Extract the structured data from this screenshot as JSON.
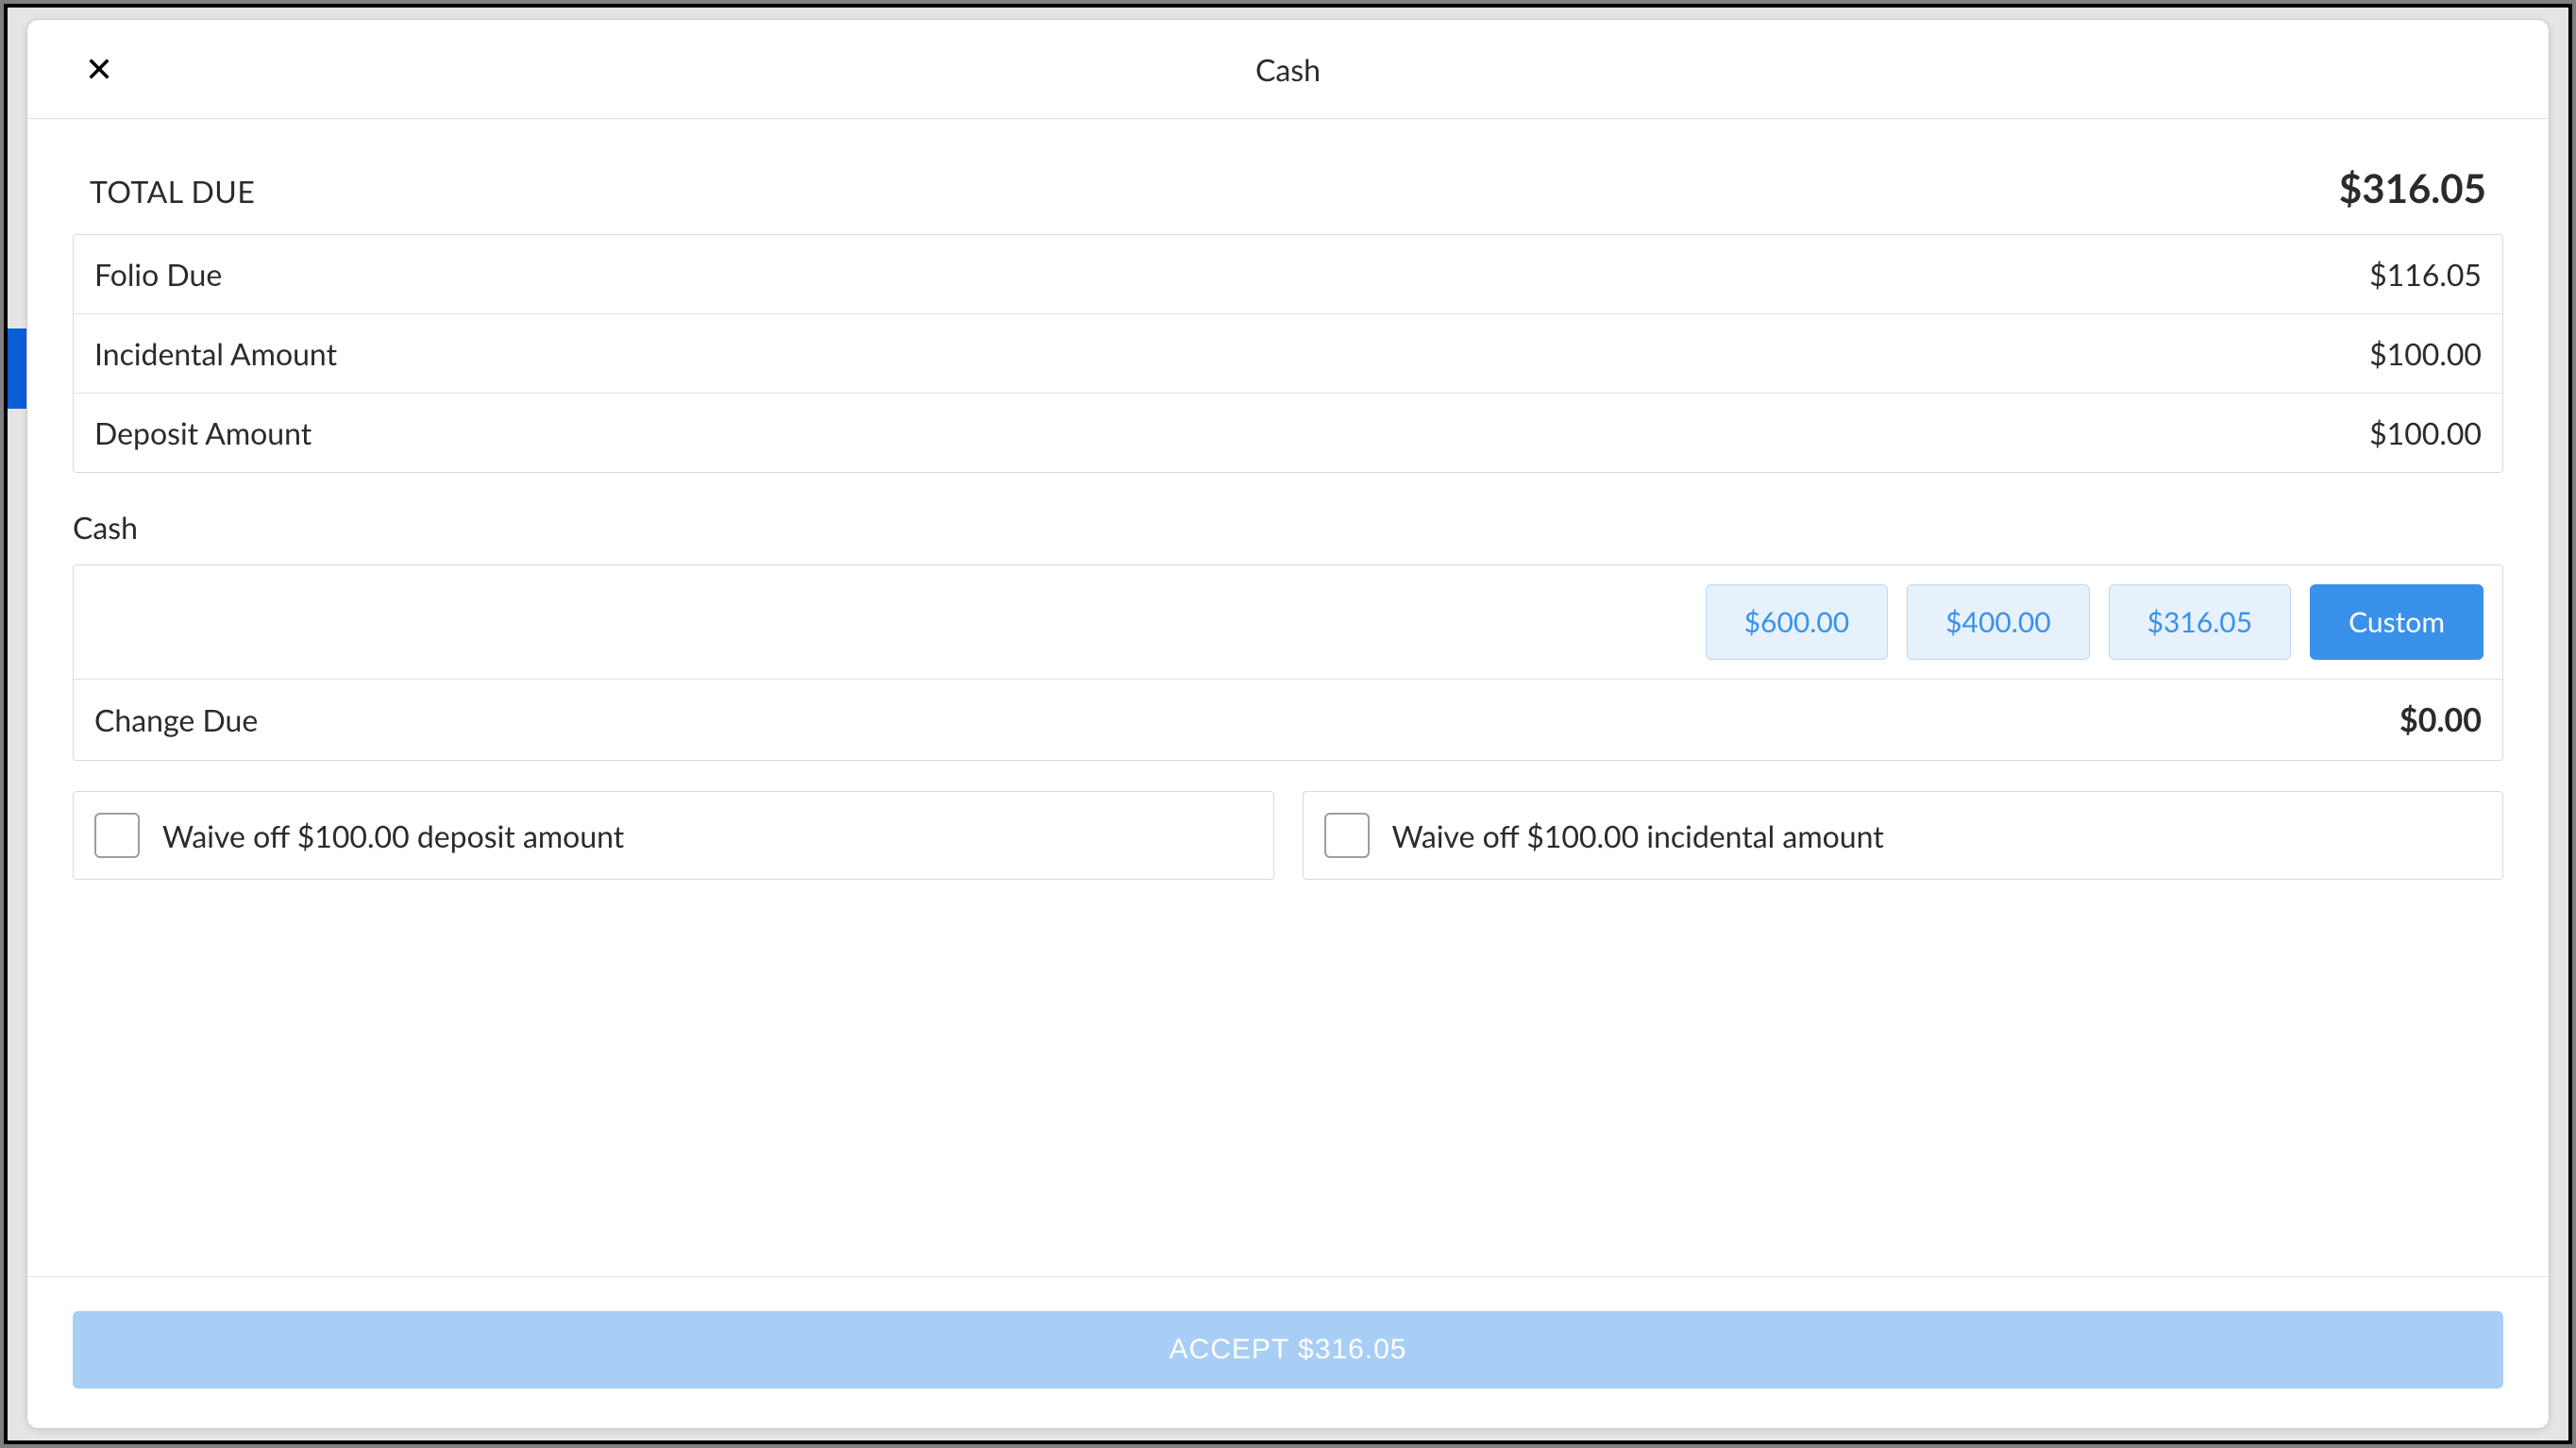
{
  "modal": {
    "title": "Cash",
    "total_due_label": "TOTAL DUE",
    "total_due_amount": "$316.05",
    "breakdown": [
      {
        "label": "Folio Due",
        "value": "$116.05"
      },
      {
        "label": "Incidental Amount",
        "value": "$100.00"
      },
      {
        "label": "Deposit Amount",
        "value": "$100.00"
      }
    ],
    "cash_section_label": "Cash",
    "quick_amounts": [
      {
        "label": "$600.00",
        "active": false
      },
      {
        "label": "$400.00",
        "active": false
      },
      {
        "label": "$316.05",
        "active": false
      },
      {
        "label": "Custom",
        "active": true
      }
    ],
    "change_due_label": "Change Due",
    "change_due_amount": "$0.00",
    "waive": [
      {
        "label": "Waive off $100.00 deposit amount"
      },
      {
        "label": "Waive off $100.00 incidental amount"
      }
    ],
    "accept_label": "ACCEPT $316.05"
  }
}
